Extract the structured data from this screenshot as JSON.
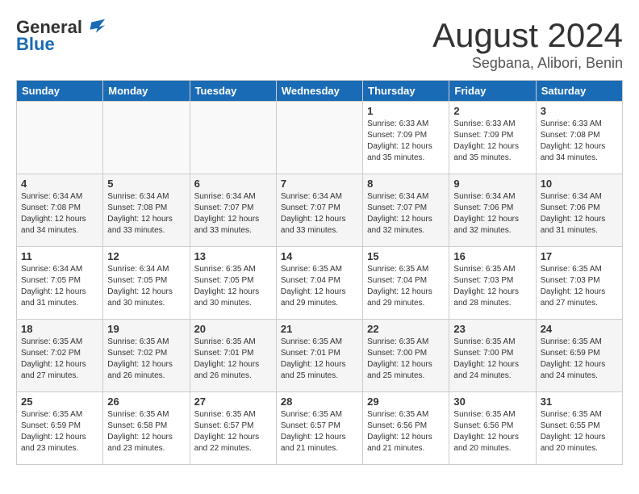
{
  "logo": {
    "general": "General",
    "blue": "Blue"
  },
  "title": {
    "month_year": "August 2024",
    "location": "Segbana, Alibori, Benin"
  },
  "days_of_week": [
    "Sunday",
    "Monday",
    "Tuesday",
    "Wednesday",
    "Thursday",
    "Friday",
    "Saturday"
  ],
  "weeks": [
    [
      {
        "day": "",
        "info": ""
      },
      {
        "day": "",
        "info": ""
      },
      {
        "day": "",
        "info": ""
      },
      {
        "day": "",
        "info": ""
      },
      {
        "day": "1",
        "info": "Sunrise: 6:33 AM\nSunset: 7:09 PM\nDaylight: 12 hours\nand 35 minutes."
      },
      {
        "day": "2",
        "info": "Sunrise: 6:33 AM\nSunset: 7:09 PM\nDaylight: 12 hours\nand 35 minutes."
      },
      {
        "day": "3",
        "info": "Sunrise: 6:33 AM\nSunset: 7:08 PM\nDaylight: 12 hours\nand 34 minutes."
      }
    ],
    [
      {
        "day": "4",
        "info": "Sunrise: 6:34 AM\nSunset: 7:08 PM\nDaylight: 12 hours\nand 34 minutes."
      },
      {
        "day": "5",
        "info": "Sunrise: 6:34 AM\nSunset: 7:08 PM\nDaylight: 12 hours\nand 33 minutes."
      },
      {
        "day": "6",
        "info": "Sunrise: 6:34 AM\nSunset: 7:07 PM\nDaylight: 12 hours\nand 33 minutes."
      },
      {
        "day": "7",
        "info": "Sunrise: 6:34 AM\nSunset: 7:07 PM\nDaylight: 12 hours\nand 33 minutes."
      },
      {
        "day": "8",
        "info": "Sunrise: 6:34 AM\nSunset: 7:07 PM\nDaylight: 12 hours\nand 32 minutes."
      },
      {
        "day": "9",
        "info": "Sunrise: 6:34 AM\nSunset: 7:06 PM\nDaylight: 12 hours\nand 32 minutes."
      },
      {
        "day": "10",
        "info": "Sunrise: 6:34 AM\nSunset: 7:06 PM\nDaylight: 12 hours\nand 31 minutes."
      }
    ],
    [
      {
        "day": "11",
        "info": "Sunrise: 6:34 AM\nSunset: 7:05 PM\nDaylight: 12 hours\nand 31 minutes."
      },
      {
        "day": "12",
        "info": "Sunrise: 6:34 AM\nSunset: 7:05 PM\nDaylight: 12 hours\nand 30 minutes."
      },
      {
        "day": "13",
        "info": "Sunrise: 6:35 AM\nSunset: 7:05 PM\nDaylight: 12 hours\nand 30 minutes."
      },
      {
        "day": "14",
        "info": "Sunrise: 6:35 AM\nSunset: 7:04 PM\nDaylight: 12 hours\nand 29 minutes."
      },
      {
        "day": "15",
        "info": "Sunrise: 6:35 AM\nSunset: 7:04 PM\nDaylight: 12 hours\nand 29 minutes."
      },
      {
        "day": "16",
        "info": "Sunrise: 6:35 AM\nSunset: 7:03 PM\nDaylight: 12 hours\nand 28 minutes."
      },
      {
        "day": "17",
        "info": "Sunrise: 6:35 AM\nSunset: 7:03 PM\nDaylight: 12 hours\nand 27 minutes."
      }
    ],
    [
      {
        "day": "18",
        "info": "Sunrise: 6:35 AM\nSunset: 7:02 PM\nDaylight: 12 hours\nand 27 minutes."
      },
      {
        "day": "19",
        "info": "Sunrise: 6:35 AM\nSunset: 7:02 PM\nDaylight: 12 hours\nand 26 minutes."
      },
      {
        "day": "20",
        "info": "Sunrise: 6:35 AM\nSunset: 7:01 PM\nDaylight: 12 hours\nand 26 minutes."
      },
      {
        "day": "21",
        "info": "Sunrise: 6:35 AM\nSunset: 7:01 PM\nDaylight: 12 hours\nand 25 minutes."
      },
      {
        "day": "22",
        "info": "Sunrise: 6:35 AM\nSunset: 7:00 PM\nDaylight: 12 hours\nand 25 minutes."
      },
      {
        "day": "23",
        "info": "Sunrise: 6:35 AM\nSunset: 7:00 PM\nDaylight: 12 hours\nand 24 minutes."
      },
      {
        "day": "24",
        "info": "Sunrise: 6:35 AM\nSunset: 6:59 PM\nDaylight: 12 hours\nand 24 minutes."
      }
    ],
    [
      {
        "day": "25",
        "info": "Sunrise: 6:35 AM\nSunset: 6:59 PM\nDaylight: 12 hours\nand 23 minutes."
      },
      {
        "day": "26",
        "info": "Sunrise: 6:35 AM\nSunset: 6:58 PM\nDaylight: 12 hours\nand 23 minutes."
      },
      {
        "day": "27",
        "info": "Sunrise: 6:35 AM\nSunset: 6:57 PM\nDaylight: 12 hours\nand 22 minutes."
      },
      {
        "day": "28",
        "info": "Sunrise: 6:35 AM\nSunset: 6:57 PM\nDaylight: 12 hours\nand 21 minutes."
      },
      {
        "day": "29",
        "info": "Sunrise: 6:35 AM\nSunset: 6:56 PM\nDaylight: 12 hours\nand 21 minutes."
      },
      {
        "day": "30",
        "info": "Sunrise: 6:35 AM\nSunset: 6:56 PM\nDaylight: 12 hours\nand 20 minutes."
      },
      {
        "day": "31",
        "info": "Sunrise: 6:35 AM\nSunset: 6:55 PM\nDaylight: 12 hours\nand 20 minutes."
      }
    ]
  ]
}
